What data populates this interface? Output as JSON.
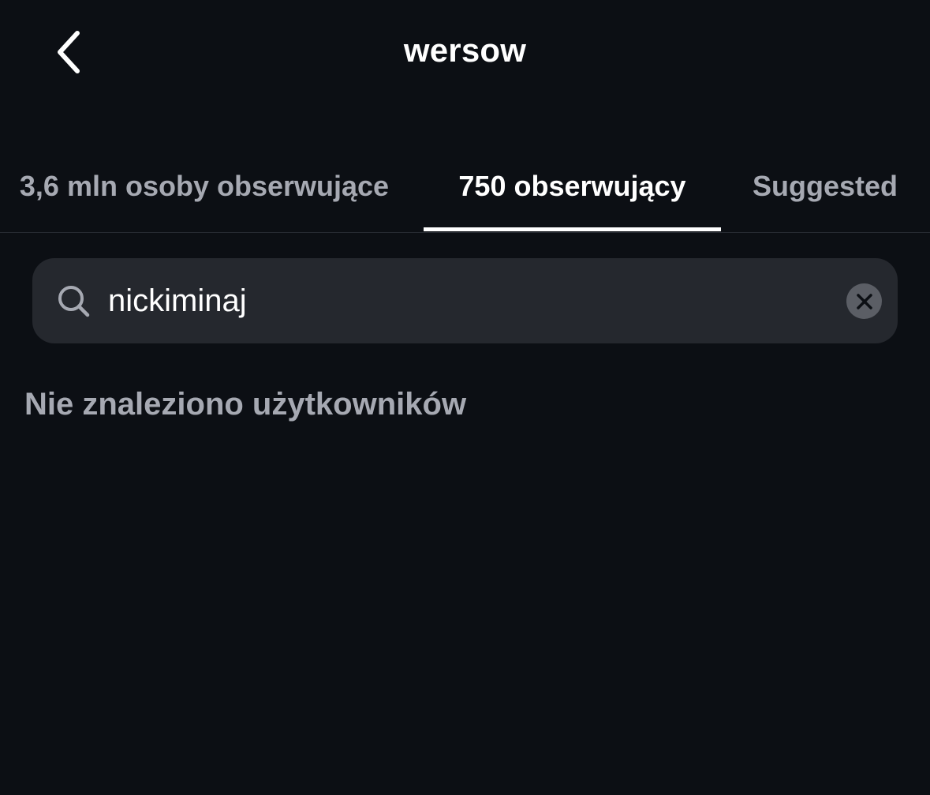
{
  "header": {
    "title": "wersow",
    "back_icon": "chevron-left-icon"
  },
  "tabs": [
    {
      "label": "3,6 mln osoby obserwujące",
      "active": false
    },
    {
      "label": "750 obserwujący",
      "active": true
    },
    {
      "label": "Suggested",
      "active": false
    }
  ],
  "search": {
    "value": "nickiminaj",
    "icon": "search-icon",
    "clear_icon": "close-icon"
  },
  "results": {
    "empty_message": "Nie znaleziono użytkowników"
  },
  "colors": {
    "background": "#0c0f14",
    "search_background": "#25282e",
    "secondary_text": "#a6a9b2",
    "primary_text": "#ffffff",
    "active_indicator": "#ffffff"
  }
}
